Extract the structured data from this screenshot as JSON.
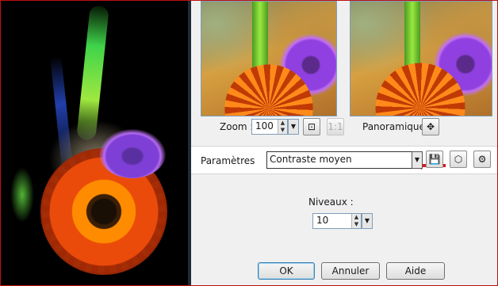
{
  "preview": {
    "zoom_label": "Zoom :",
    "zoom_value": "100",
    "pan_label": "Panoramique :"
  },
  "params": {
    "label": "Paramètres",
    "preset_value": "Contraste moyen"
  },
  "levels": {
    "label": "Niveaux :",
    "value": "10"
  },
  "buttons": {
    "ok": "OK",
    "cancel": "Annuler",
    "help": "Aide"
  },
  "icons": {
    "zoom_fit": "zoom-fit-icon",
    "zoom_actual": "actual-size-icon",
    "pan": "pan-cross-icon",
    "save": "save-preset-icon",
    "cube": "reset-cube-icon",
    "manage": "manage-presets-icon"
  },
  "colors": {
    "frame_border": "#c01010",
    "annotation_arrow": "#e01818",
    "dialog_bg": "#f0f0f0"
  }
}
